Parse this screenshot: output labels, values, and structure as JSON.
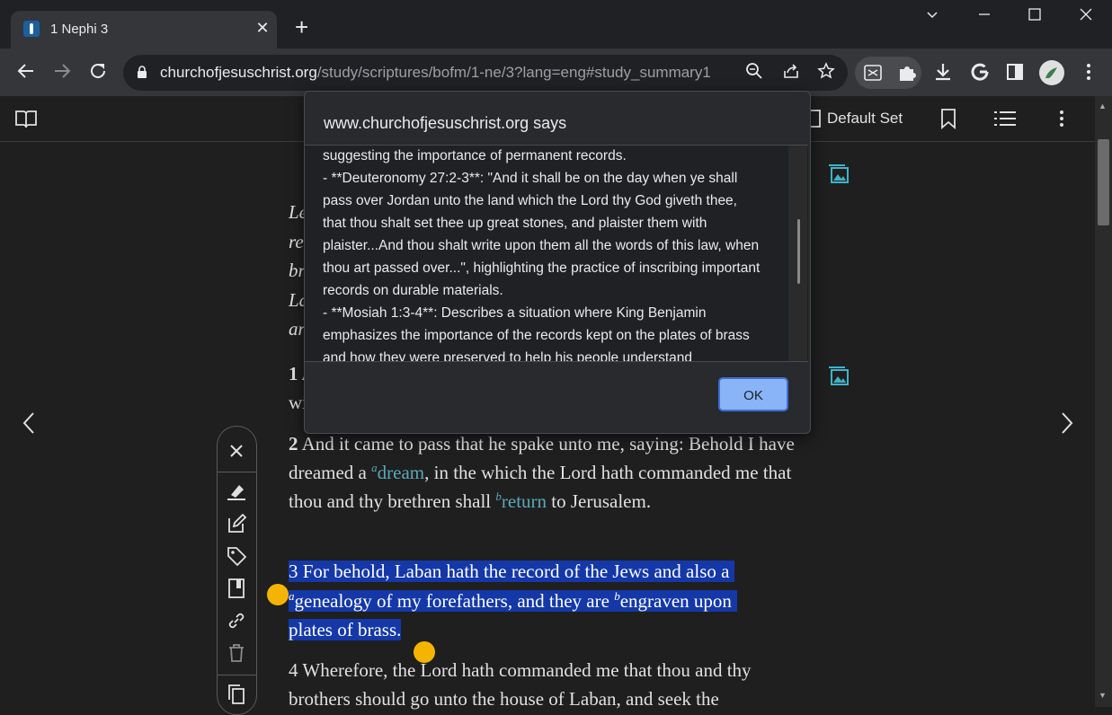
{
  "browser": {
    "tab_title": "1 Nephi 3",
    "tab_close": "✕",
    "new_tab": "+",
    "url_host": "churchofjesuschrist.org",
    "url_path": "/study/scriptures/bofm/1-ne/3?lang=eng#study_summary1",
    "window_controls": {
      "dropdown": "⌄",
      "minimize": "─",
      "maximize": "☐",
      "close": "✕"
    }
  },
  "app_header": {
    "set_label": "Default Set"
  },
  "verses": {
    "v1_partial": "1 A",
    "v1_line2": "wi",
    "v2_num": "2",
    "v2_a": "And it came to pass that he spake unto me, saying: Behold I have dreamed a ",
    "v2_fn_a": "a",
    "v2_link_a": "dream",
    "v2_b": ", in the which the Lord hath commanded me that thou and thy brethren shall ",
    "v2_fn_b": "b",
    "v2_link_b": "return",
    "v2_c": " to Jerusalem.",
    "v3_line1": "3 For behold, Laban hath the record of the Jews and also a",
    "v3_fn_a": "a",
    "v3_line2a": "genealogy of my forefathers, and they are ",
    "v3_fn_b": "b",
    "v3_line2b": "engraven upon",
    "v3_line3": "plates of brass.",
    "v4_line1": "4 Wherefore, the Lord hath commanded me that thou and thy",
    "v4_line2": "brothers should go unto the house of Laban, and seek the"
  },
  "summary_partial": {
    "l1": "Le",
    "l2": "re",
    "l3": "br",
    "l4": "La",
    "l5": "an"
  },
  "dialog": {
    "title": "www.churchofjesuschrist.org says",
    "body": "suggesting the importance of permanent records.\n- **Deuteronomy 27:2-3**: \"And it shall be on the day when ye shall pass over Jordan unto the land which the Lord thy God giveth thee, that thou shalt set thee up great stones, and plaister them with plaister...And thou shalt write upon them all the words of this law, when thou art passed over...\", highlighting the practice of inscribing important records on durable materials.\n- **Mosiah 1:3-4**: Describes a situation where King Benjamin emphasizes the importance of the records kept on the plates of brass and how they were preserved to help his people understand",
    "ok_label": "OK"
  },
  "colors": {
    "highlight": "#1438a8",
    "footnote_link": "#5aa9b8",
    "handle": "#f5b400",
    "ok_button": "#8ab4f8"
  }
}
